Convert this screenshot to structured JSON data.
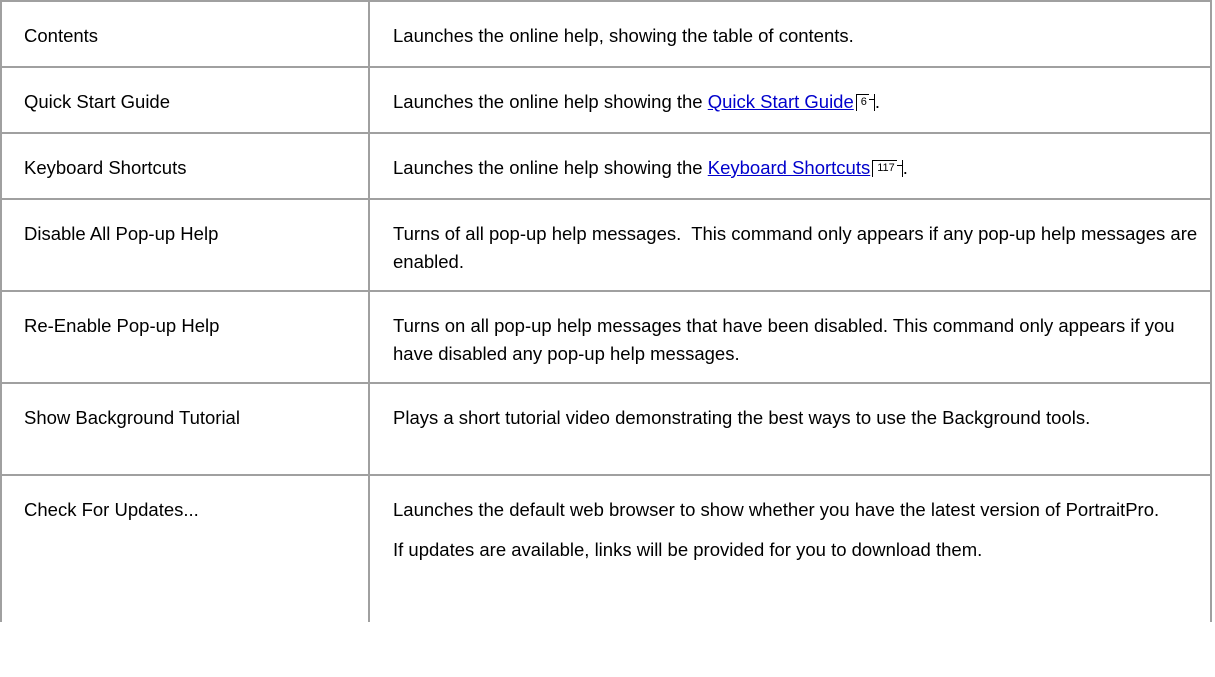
{
  "rows": [
    {
      "command": "Contents",
      "paragraphs": [
        "Launches the online help, showing the table of contents."
      ]
    },
    {
      "command": "Quick Start Guide",
      "prefix": "Launches the online help showing the ",
      "link": "Quick Start Guide",
      "page": "6",
      "suffix": "."
    },
    {
      "command": "Keyboard Shortcuts",
      "prefix": "Launches the online help showing the ",
      "link": "Keyboard Shortcuts",
      "page": "117",
      "suffix": "."
    },
    {
      "command": "Disable All Pop-up Help",
      "paragraphs": [
        "Turns of all pop-up help messages.  This command only appears if any pop-up help messages are enabled."
      ]
    },
    {
      "command": "Re-Enable Pop-up Help",
      "paragraphs": [
        "Turns on all pop-up help messages that have been disabled. This command only appears if you have disabled any pop-up help messages."
      ]
    },
    {
      "command": "Show Background Tutorial",
      "paragraphs": [
        "Plays a short tutorial video demonstrating the best ways to use the Background tools."
      ]
    },
    {
      "command": "Check For Updates...",
      "paragraphs": [
        "Launches the default web browser to show whether you have the latest version of PortraitPro.",
        "If updates are available, links will be provided for you to download them."
      ]
    }
  ]
}
